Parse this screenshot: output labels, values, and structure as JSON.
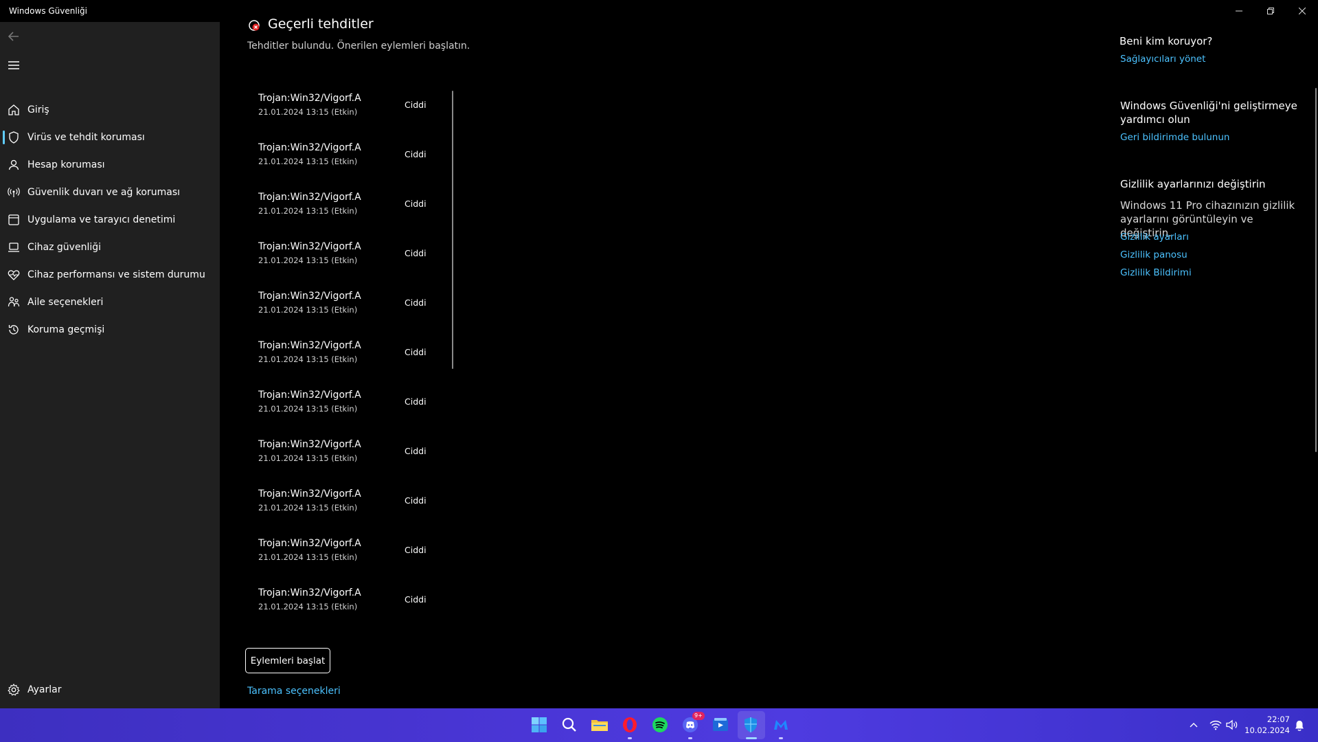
{
  "window": {
    "title": "Windows Güvenliği",
    "controls": [
      "minimize-icon",
      "restore-icon",
      "close-icon"
    ]
  },
  "sidebar": {
    "items": [
      {
        "label": "Giriş",
        "icon": "home-icon"
      },
      {
        "label": "Virüs ve tehdit koruması",
        "icon": "shield-icon",
        "selected": true
      },
      {
        "label": "Hesap koruması",
        "icon": "person-icon"
      },
      {
        "label": "Güvenlik duvarı ve ağ koruması",
        "icon": "antenna-icon"
      },
      {
        "label": "Uygulama ve tarayıcı denetimi",
        "icon": "app-window-icon"
      },
      {
        "label": "Cihaz güvenliği",
        "icon": "laptop-icon"
      },
      {
        "label": "Cihaz performansı ve sistem durumu",
        "icon": "heart-pulse-icon"
      },
      {
        "label": "Aile seçenekleri",
        "icon": "family-icon"
      },
      {
        "label": "Koruma geçmişi",
        "icon": "history-icon"
      }
    ],
    "settings_label": "Ayarlar"
  },
  "main": {
    "section_title": "Geçerli tehditler",
    "subtitle": "Tehditler bulundu. Önerilen eylemleri başlatın.",
    "threats": [
      {
        "name": "Trojan:Win32/Vigorf.A",
        "date": "21.01.2024 13:15 (Etkin)",
        "severity": "Ciddi"
      },
      {
        "name": "Trojan:Win32/Vigorf.A",
        "date": "21.01.2024 13:15 (Etkin)",
        "severity": "Ciddi"
      },
      {
        "name": "Trojan:Win32/Vigorf.A",
        "date": "21.01.2024 13:15 (Etkin)",
        "severity": "Ciddi"
      },
      {
        "name": "Trojan:Win32/Vigorf.A",
        "date": "21.01.2024 13:15 (Etkin)",
        "severity": "Ciddi"
      },
      {
        "name": "Trojan:Win32/Vigorf.A",
        "date": "21.01.2024 13:15 (Etkin)",
        "severity": "Ciddi"
      },
      {
        "name": "Trojan:Win32/Vigorf.A",
        "date": "21.01.2024 13:15 (Etkin)",
        "severity": "Ciddi"
      },
      {
        "name": "Trojan:Win32/Vigorf.A",
        "date": "21.01.2024 13:15 (Etkin)",
        "severity": "Ciddi"
      },
      {
        "name": "Trojan:Win32/Vigorf.A",
        "date": "21.01.2024 13:15 (Etkin)",
        "severity": "Ciddi"
      },
      {
        "name": "Trojan:Win32/Vigorf.A",
        "date": "21.01.2024 13:15 (Etkin)",
        "severity": "Ciddi"
      },
      {
        "name": "Trojan:Win32/Vigorf.A",
        "date": "21.01.2024 13:15 (Etkin)",
        "severity": "Ciddi"
      },
      {
        "name": "Trojan:Win32/Vigorf.A",
        "date": "21.01.2024 13:15 (Etkin)",
        "severity": "Ciddi"
      }
    ],
    "start_actions_label": "Eylemleri başlat",
    "scan_options_label": "Tarama seçenekleri"
  },
  "right_panel": {
    "protect_heading": "Beni kim koruyor?",
    "protect_link": "Sağlayıcıları yönet",
    "improve_heading": "Windows Güvenliği'ni geliştirmeye yardımcı olun",
    "improve_link": "Geri bildirimde bulunun",
    "privacy_heading": "Gizlilik ayarlarınızı değiştirin",
    "privacy_text": "Windows 11 Pro cihazınızın gizlilik ayarlarını görüntüleyin ve değiştirin.",
    "privacy_links": [
      "Gizlilik ayarları",
      "Gizlilik panosu",
      "Gizlilik Bildirimi"
    ]
  },
  "taskbar": {
    "apps": [
      "windows-start-icon",
      "search-icon",
      "file-explorer-icon",
      "opera-icon",
      "spotify-icon",
      "discord-icon",
      "video-editor-icon",
      "windows-security-icon",
      "malwarebytes-icon"
    ],
    "discord_badge": "9+",
    "time": "22:07",
    "date": "10.02.2024"
  },
  "colors": {
    "accent": "#4cc2ff",
    "sidebar_bg": "#202020",
    "taskbar": "#4a36d6"
  }
}
